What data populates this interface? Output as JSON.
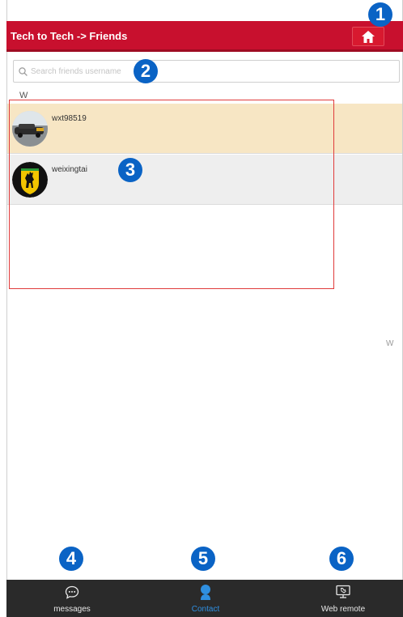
{
  "header": {
    "title": "Tech to Tech -> Friends",
    "home_icon": "home-icon"
  },
  "search": {
    "placeholder": "Search friends username",
    "icon": "search-icon"
  },
  "contacts": {
    "section_letter": "W",
    "items": [
      {
        "name": "wxt98519",
        "avatar": "car-photo-avatar"
      },
      {
        "name": "weixingtai",
        "avatar": "ferrari-logo-avatar"
      }
    ],
    "index_letter": "W"
  },
  "annotations": {
    "markers": [
      "1",
      "2",
      "3",
      "4",
      "5",
      "6"
    ],
    "marker_color": "#0a63c5",
    "highlight_color": "#e03b3b"
  },
  "bottom_nav": {
    "items": [
      {
        "label": "messages",
        "icon": "chat-bubble-icon",
        "active": false
      },
      {
        "label": "Contact",
        "icon": "contact-person-icon",
        "active": true
      },
      {
        "label": "Web remote",
        "icon": "monitor-icon",
        "active": false
      }
    ]
  },
  "colors": {
    "header_bg": "#c8102e",
    "selected_row_bg": "#f7e6c4",
    "bottom_bar_bg": "#2a2a2a",
    "active_accent": "#2f8fe0"
  }
}
